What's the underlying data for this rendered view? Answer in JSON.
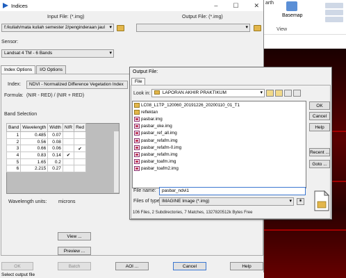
{
  "window": {
    "title": "Indices"
  },
  "input_file": {
    "label": "Input File: (*.img)",
    "value": "f:/kuliah/mata kuliah semester 2/penginderaan jaul"
  },
  "output_file": {
    "label": "Output File: (*.img)",
    "value": ""
  },
  "sensor": {
    "label": "Sensor:",
    "value": "Landsat 4 TM - 6 Bands"
  },
  "tabs": [
    {
      "label": "Index Options"
    },
    {
      "label": "I/O Options"
    }
  ],
  "index": {
    "label": "Index:",
    "value": "NDVI - Normalized Difference Vegetation Index"
  },
  "formula": {
    "label": "Formula:",
    "value": "(NIR - RED) / (NIR + RED)"
  },
  "band_selection": {
    "label": "Band Selection",
    "headers": [
      "Band",
      "Wavelength",
      "Width",
      "NIR",
      "Red"
    ],
    "rows": [
      {
        "band": "1",
        "wavelength": "0.485",
        "width": "0.07",
        "nir": "",
        "red": ""
      },
      {
        "band": "2",
        "wavelength": "0.56",
        "width": "0.08",
        "nir": "",
        "red": ""
      },
      {
        "band": "3",
        "wavelength": "0.66",
        "width": "0.06",
        "nir": "",
        "red": "✔"
      },
      {
        "band": "4",
        "wavelength": "0.83",
        "width": "0.14",
        "nir": "✔",
        "red": ""
      },
      {
        "band": "5",
        "wavelength": "1.65",
        "width": "0.2",
        "nir": "",
        "red": ""
      },
      {
        "band": "6",
        "wavelength": "2.215",
        "width": "0.27",
        "nir": "",
        "red": ""
      }
    ]
  },
  "wavelength_units": {
    "label": "Wavelength units:",
    "value": "microns"
  },
  "buttons": {
    "view": "View ...",
    "preview": "Preview ...",
    "ok": "OK",
    "batch": "Batch",
    "aoi": "AOI ...",
    "cancel": "Cancel",
    "help": "Help"
  },
  "status": "Select output file",
  "dialog": {
    "title": "Output File:",
    "tab": "File",
    "look_in_label": "Look in:",
    "look_in_value": "LAPORAN AKHIR PRAKTIKUM",
    "files": [
      {
        "name": "LC08_L1TP_120060_20191226_20200110_01_T1",
        "type": "folder"
      },
      {
        "name": "reflektan",
        "type": "folder"
      },
      {
        "name": "pasbar.img",
        "type": "img"
      },
      {
        "name": "pasbar_oke.img",
        "type": "img"
      },
      {
        "name": "pasbar_ref_all.img",
        "type": "img"
      },
      {
        "name": "pasbar_refafm.img",
        "type": "img"
      },
      {
        "name": "pasbar_refafm-0.img",
        "type": "img"
      },
      {
        "name": "pasbar_refafm.img",
        "type": "img"
      },
      {
        "name": "pasbar_toafm.img",
        "type": "img"
      },
      {
        "name": "pasbar_toafm2.img",
        "type": "img"
      }
    ],
    "file_name_label": "File name:",
    "file_name_value": "pasbar_ndvi1",
    "file_type_label": "Files of type:",
    "file_type_value": "IMAGINE Image (*.img)",
    "summary": "106 Files, 2 Subdirectories, 7 Matches, 1327820512k Bytes Free",
    "buttons": {
      "ok": "OK",
      "cancel": "Cancel",
      "help": "Help",
      "recent": "Recent ...",
      "goto": "Goto ..."
    }
  },
  "background_app": {
    "tab_text": "arth",
    "basemap": "Basemap",
    "view": "View"
  }
}
